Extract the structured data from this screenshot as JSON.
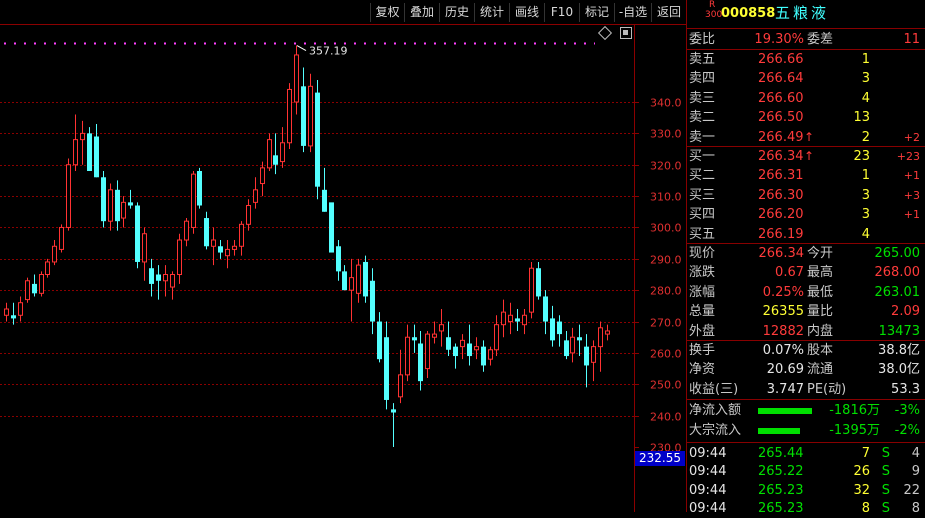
{
  "toolbar": {
    "buttons": [
      "复权",
      "叠加",
      "历史",
      "统计",
      "画线",
      "F10",
      "标记",
      "-自选",
      "返回"
    ]
  },
  "chart": {
    "max_label": "357.19",
    "current_price_tag": "232.55",
    "y_ticks": [
      "340.0",
      "330.0",
      "320.0",
      "310.0",
      "300.0",
      "290.0",
      "280.0",
      "270.0",
      "260.0",
      "250.0",
      "240.0",
      "230.0"
    ]
  },
  "chart_data": {
    "type": "candlestick",
    "ylim": [
      228,
      362
    ],
    "candles": [
      {
        "o": 272,
        "h": 276,
        "l": 270,
        "c": 274
      },
      {
        "o": 272,
        "h": 276,
        "l": 269,
        "c": 271
      },
      {
        "o": 272,
        "h": 278,
        "l": 270,
        "c": 276
      },
      {
        "o": 277,
        "h": 284,
        "l": 276,
        "c": 283
      },
      {
        "o": 282,
        "h": 285,
        "l": 278,
        "c": 279
      },
      {
        "o": 279,
        "h": 286,
        "l": 278,
        "c": 285
      },
      {
        "o": 285,
        "h": 290,
        "l": 284,
        "c": 289
      },
      {
        "o": 289,
        "h": 296,
        "l": 288,
        "c": 294
      },
      {
        "o": 293,
        "h": 301,
        "l": 292,
        "c": 300
      },
      {
        "o": 300,
        "h": 322,
        "l": 299,
        "c": 320
      },
      {
        "o": 320,
        "h": 336,
        "l": 318,
        "c": 328
      },
      {
        "o": 328,
        "h": 334,
        "l": 320,
        "c": 330
      },
      {
        "o": 330,
        "h": 332,
        "l": 318,
        "c": 318
      },
      {
        "o": 329,
        "h": 333,
        "l": 316,
        "c": 316
      },
      {
        "o": 316,
        "h": 318,
        "l": 300,
        "c": 302
      },
      {
        "o": 302,
        "h": 314,
        "l": 299,
        "c": 312
      },
      {
        "o": 312,
        "h": 315,
        "l": 299,
        "c": 302
      },
      {
        "o": 303,
        "h": 310,
        "l": 300,
        "c": 308
      },
      {
        "o": 308,
        "h": 312,
        "l": 306,
        "c": 307
      },
      {
        "o": 307,
        "h": 308,
        "l": 287,
        "c": 289
      },
      {
        "o": 289,
        "h": 300,
        "l": 283,
        "c": 298
      },
      {
        "o": 287,
        "h": 290,
        "l": 278,
        "c": 282
      },
      {
        "o": 285,
        "h": 288,
        "l": 277,
        "c": 283
      },
      {
        "o": 283,
        "h": 288,
        "l": 278,
        "c": 285
      },
      {
        "o": 281,
        "h": 286,
        "l": 277,
        "c": 285
      },
      {
        "o": 285,
        "h": 298,
        "l": 282,
        "c": 296
      },
      {
        "o": 296,
        "h": 303,
        "l": 294,
        "c": 302
      },
      {
        "o": 300,
        "h": 318,
        "l": 298,
        "c": 317
      },
      {
        "o": 318,
        "h": 319,
        "l": 306,
        "c": 307
      },
      {
        "o": 303,
        "h": 305,
        "l": 293,
        "c": 294
      },
      {
        "o": 294,
        "h": 300,
        "l": 288,
        "c": 296
      },
      {
        "o": 294,
        "h": 296,
        "l": 290,
        "c": 292
      },
      {
        "o": 291,
        "h": 296,
        "l": 287,
        "c": 293
      },
      {
        "o": 293,
        "h": 296,
        "l": 291,
        "c": 294
      },
      {
        "o": 294,
        "h": 302,
        "l": 291,
        "c": 301
      },
      {
        "o": 301,
        "h": 309,
        "l": 299,
        "c": 307
      },
      {
        "o": 308,
        "h": 316,
        "l": 306,
        "c": 312
      },
      {
        "o": 314,
        "h": 321,
        "l": 310,
        "c": 319
      },
      {
        "o": 319,
        "h": 330,
        "l": 318,
        "c": 328
      },
      {
        "o": 323,
        "h": 330,
        "l": 317,
        "c": 320
      },
      {
        "o": 321,
        "h": 332,
        "l": 319,
        "c": 327
      },
      {
        "o": 327,
        "h": 346,
        "l": 325,
        "c": 344
      },
      {
        "o": 340,
        "h": 358,
        "l": 336,
        "c": 355
      },
      {
        "o": 345,
        "h": 351,
        "l": 324,
        "c": 326
      },
      {
        "o": 326,
        "h": 349,
        "l": 324,
        "c": 345
      },
      {
        "o": 343,
        "h": 347,
        "l": 309,
        "c": 313
      },
      {
        "o": 312,
        "h": 319,
        "l": 305,
        "c": 305
      },
      {
        "o": 308,
        "h": 300,
        "l": 292,
        "c": 292
      },
      {
        "o": 294,
        "h": 296,
        "l": 283,
        "c": 286
      },
      {
        "o": 286,
        "h": 288,
        "l": 280,
        "c": 280
      },
      {
        "o": 280,
        "h": 290,
        "l": 270,
        "c": 284
      },
      {
        "o": 279,
        "h": 290,
        "l": 276,
        "c": 288
      },
      {
        "o": 289,
        "h": 291,
        "l": 276,
        "c": 278
      },
      {
        "o": 283,
        "h": 287,
        "l": 266,
        "c": 270
      },
      {
        "o": 270,
        "h": 273,
        "l": 257,
        "c": 258
      },
      {
        "o": 265,
        "h": 270,
        "l": 242,
        "c": 245
      },
      {
        "o": 242,
        "h": 244,
        "l": 230,
        "c": 241
      },
      {
        "o": 246,
        "h": 261,
        "l": 244,
        "c": 253
      },
      {
        "o": 253,
        "h": 269,
        "l": 251,
        "c": 265
      },
      {
        "o": 265,
        "h": 269,
        "l": 260,
        "c": 264
      },
      {
        "o": 263,
        "h": 267,
        "l": 248,
        "c": 251
      },
      {
        "o": 255,
        "h": 267,
        "l": 252,
        "c": 266
      },
      {
        "o": 265,
        "h": 270,
        "l": 263,
        "c": 266
      },
      {
        "o": 267,
        "h": 274,
        "l": 262,
        "c": 269
      },
      {
        "o": 265,
        "h": 270,
        "l": 259,
        "c": 261
      },
      {
        "o": 262,
        "h": 263,
        "l": 255,
        "c": 259
      },
      {
        "o": 262,
        "h": 266,
        "l": 258,
        "c": 264
      },
      {
        "o": 263,
        "h": 269,
        "l": 256,
        "c": 259
      },
      {
        "o": 261,
        "h": 265,
        "l": 258,
        "c": 262
      },
      {
        "o": 262,
        "h": 264,
        "l": 254,
        "c": 256
      },
      {
        "o": 258,
        "h": 262,
        "l": 256,
        "c": 261
      },
      {
        "o": 261,
        "h": 272,
        "l": 259,
        "c": 269
      },
      {
        "o": 269,
        "h": 277,
        "l": 265,
        "c": 273
      },
      {
        "o": 270,
        "h": 276,
        "l": 266,
        "c": 272
      },
      {
        "o": 271,
        "h": 274,
        "l": 267,
        "c": 270
      },
      {
        "o": 269,
        "h": 274,
        "l": 266,
        "c": 272
      },
      {
        "o": 273,
        "h": 289,
        "l": 271,
        "c": 287
      },
      {
        "o": 287,
        "h": 289,
        "l": 277,
        "c": 278
      },
      {
        "o": 278,
        "h": 280,
        "l": 266,
        "c": 270
      },
      {
        "o": 271,
        "h": 275,
        "l": 262,
        "c": 264
      },
      {
        "o": 270,
        "h": 272,
        "l": 262,
        "c": 266
      },
      {
        "o": 264,
        "h": 267,
        "l": 258,
        "c": 259
      },
      {
        "o": 260,
        "h": 268,
        "l": 257,
        "c": 265
      },
      {
        "o": 265,
        "h": 269,
        "l": 259,
        "c": 264
      },
      {
        "o": 262,
        "h": 266,
        "l": 249,
        "c": 256
      },
      {
        "o": 257,
        "h": 264,
        "l": 251,
        "c": 262
      },
      {
        "o": 262,
        "h": 270,
        "l": 254,
        "c": 268
      },
      {
        "o": 266,
        "h": 269,
        "l": 264,
        "c": 267
      }
    ]
  },
  "quote": {
    "board_tag_r": "R",
    "board_tag_num": "300",
    "code": "000858",
    "name": "五粮液",
    "weibi_label": "委比",
    "weibi_value": "19.30%",
    "weicha_label": "委差",
    "weicha_value": "11",
    "asks": [
      {
        "label": "卖五",
        "price": "266.66",
        "vol": "1",
        "chg": ""
      },
      {
        "label": "卖四",
        "price": "266.64",
        "vol": "3",
        "chg": ""
      },
      {
        "label": "卖三",
        "price": "266.60",
        "vol": "4",
        "chg": ""
      },
      {
        "label": "卖二",
        "price": "266.50",
        "vol": "13",
        "chg": ""
      },
      {
        "label": "卖一",
        "price": "266.49",
        "arrow": "↑",
        "vol": "2",
        "chg": "+2"
      }
    ],
    "bids": [
      {
        "label": "买一",
        "price": "266.34",
        "arrow": "↑",
        "vol": "23",
        "chg": "+23"
      },
      {
        "label": "买二",
        "price": "266.31",
        "vol": "1",
        "chg": "+1"
      },
      {
        "label": "买三",
        "price": "266.30",
        "vol": "3",
        "chg": "+3"
      },
      {
        "label": "买四",
        "price": "266.20",
        "vol": "3",
        "chg": "+1"
      },
      {
        "label": "买五",
        "price": "266.19",
        "vol": "4",
        "chg": ""
      }
    ],
    "stats": [
      {
        "l1": "现价",
        "v1": "266.34",
        "c1": "red",
        "l2": "今开",
        "v2": "265.00",
        "c2": "green"
      },
      {
        "l1": "涨跌",
        "v1": "0.67",
        "c1": "red",
        "l2": "最高",
        "v2": "268.00",
        "c2": "red"
      },
      {
        "l1": "涨幅",
        "v1": "0.25%",
        "c1": "red",
        "l2": "最低",
        "v2": "263.01",
        "c2": "green"
      },
      {
        "l1": "总量",
        "v1": "26355",
        "c1": "yellow",
        "l2": "量比",
        "v2": "2.09",
        "c2": "red"
      },
      {
        "l1": "外盘",
        "v1": "12882",
        "c1": "red",
        "l2": "内盘",
        "v2": "13473",
        "c2": "green"
      }
    ],
    "fin": [
      {
        "l1": "换手",
        "v1": "0.07%",
        "l2": "股本",
        "v2": "38.8亿"
      },
      {
        "l1": "净资",
        "v1": "20.69",
        "l2": "流通",
        "v2": "38.0亿"
      },
      {
        "l1": "收益(三)",
        "v1": "3.747",
        "l2": "PE(动)",
        "v2": "53.3"
      }
    ],
    "flows": [
      {
        "label": "净流入额",
        "amount": "-1816万",
        "pct": "-3%",
        "bar": 0.9
      },
      {
        "label": "大宗流入",
        "amount": "-1395万",
        "pct": "-2%",
        "bar": 0.7
      }
    ],
    "ticks": [
      {
        "time": "09:44",
        "price": "265.44",
        "vol": "7",
        "side": "S",
        "n": "4"
      },
      {
        "time": "09:44",
        "price": "265.22",
        "vol": "26",
        "side": "S",
        "n": "9"
      },
      {
        "time": "09:44",
        "price": "265.23",
        "vol": "32",
        "side": "S",
        "n": "22"
      },
      {
        "time": "09:44",
        "price": "265.23",
        "vol": "8",
        "side": "S",
        "n": "8"
      }
    ]
  },
  "colors": {
    "up": "#ff3232",
    "down": "#54ffff",
    "grid": "#8b0000",
    "axis_text": "#e03030",
    "price_tag_bg": "#0000c8"
  }
}
